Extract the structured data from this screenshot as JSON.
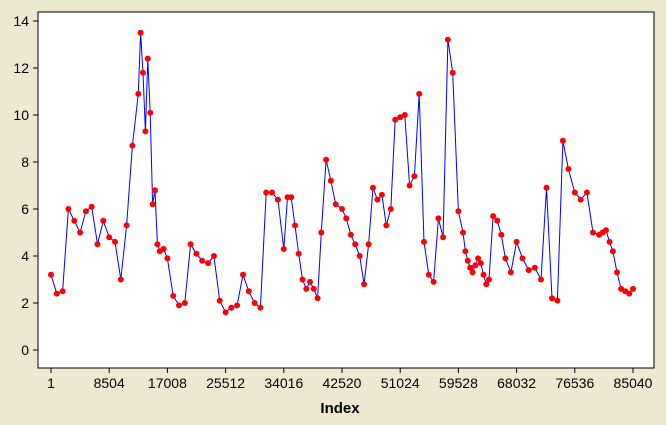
{
  "colors": {
    "frame_bg": "#ede9d0",
    "plot_bg": "#ffffff",
    "axis": "#000000",
    "line": "#0000ff",
    "points": "#ff0000"
  },
  "chart_data": {
    "type": "scatter",
    "title": "",
    "xlabel": "Index",
    "ylabel": "",
    "xlim": [
      1,
      85040
    ],
    "ylim": [
      0,
      14
    ],
    "grid": false,
    "connect_line": true,
    "x_ticks": [
      1,
      8504,
      17008,
      25512,
      34016,
      42520,
      51024,
      59528,
      68032,
      76536,
      85040
    ],
    "x_tick_labels": [
      "1",
      "8504",
      "17008",
      "25512",
      "34016",
      "42520",
      "51024",
      "59528",
      "68032",
      "76536",
      "85040"
    ],
    "y_ticks": [
      0,
      2,
      4,
      6,
      8,
      10,
      12,
      14
    ],
    "y_tick_labels": [
      "0",
      "2",
      "4",
      "6",
      "8",
      "10",
      "12",
      "14"
    ],
    "series": [
      {
        "x": [
          1,
          850,
          1700,
          2550,
          3400,
          4250,
          5100,
          5950,
          6800,
          7650,
          8504,
          9350,
          10200,
          11050,
          11900,
          12750,
          13100,
          13450,
          13800,
          14150,
          14500,
          14850,
          15200,
          15550,
          15900,
          16450,
          17008,
          17850,
          18700,
          19550,
          20400,
          21250,
          22100,
          22950,
          23800,
          24650,
          25512,
          26350,
          27200,
          28050,
          28900,
          29750,
          30600,
          31450,
          32300,
          33150,
          34016,
          34550,
          35100,
          35650,
          36200,
          36750,
          37300,
          37850,
          38400,
          38950,
          39500,
          40200,
          40900,
          41600,
          42520,
          43150,
          43800,
          44450,
          45100,
          45750,
          46400,
          47050,
          47700,
          48350,
          49000,
          49650,
          50300,
          51024,
          51700,
          52400,
          53100,
          53800,
          54500,
          55200,
          55900,
          56600,
          57300,
          58000,
          58700,
          59528,
          60200,
          60550,
          60900,
          61250,
          61600,
          62000,
          62400,
          62800,
          63200,
          63600,
          64000,
          64600,
          65200,
          65800,
          66400,
          67200,
          68032,
          68900,
          69800,
          70700,
          71600,
          72400,
          73200,
          74000,
          74800,
          75600,
          76536,
          77400,
          78300,
          79200,
          80100,
          80600,
          81100,
          81600,
          82100,
          82700,
          83300,
          83900,
          84500,
          85040
        ],
        "y": [
          3.2,
          2.4,
          2.5,
          6.0,
          5.5,
          5.0,
          5.9,
          6.1,
          4.5,
          5.5,
          4.8,
          4.6,
          3.0,
          5.3,
          8.7,
          10.9,
          13.5,
          11.8,
          9.3,
          12.4,
          10.1,
          6.2,
          6.8,
          4.5,
          4.2,
          4.3,
          3.9,
          2.3,
          1.9,
          2.0,
          4.5,
          4.1,
          3.8,
          3.7,
          4.0,
          2.1,
          1.6,
          1.8,
          1.9,
          3.2,
          2.5,
          2.0,
          1.8,
          6.7,
          6.7,
          6.4,
          4.3,
          6.5,
          6.5,
          5.3,
          4.1,
          3.0,
          2.6,
          2.9,
          2.6,
          2.2,
          5.0,
          8.1,
          7.2,
          6.2,
          6.0,
          5.6,
          4.9,
          4.5,
          4.0,
          2.8,
          4.5,
          6.9,
          6.4,
          6.6,
          5.3,
          6.0,
          9.8,
          9.9,
          10.0,
          7.0,
          7.4,
          10.9,
          4.6,
          3.2,
          2.9,
          5.6,
          4.8,
          13.2,
          11.8,
          5.9,
          5.0,
          4.2,
          3.8,
          3.5,
          3.3,
          3.6,
          3.9,
          3.7,
          3.2,
          2.8,
          3.0,
          5.7,
          5.5,
          4.9,
          3.9,
          3.3,
          4.6,
          3.9,
          3.4,
          3.5,
          3.0,
          6.9,
          2.2,
          2.1,
          8.9,
          7.7,
          6.7,
          6.4,
          6.7,
          5.0,
          4.9,
          5.0,
          5.1,
          4.6,
          4.2,
          3.3,
          2.6,
          2.5,
          2.4,
          2.6
        ]
      }
    ]
  }
}
